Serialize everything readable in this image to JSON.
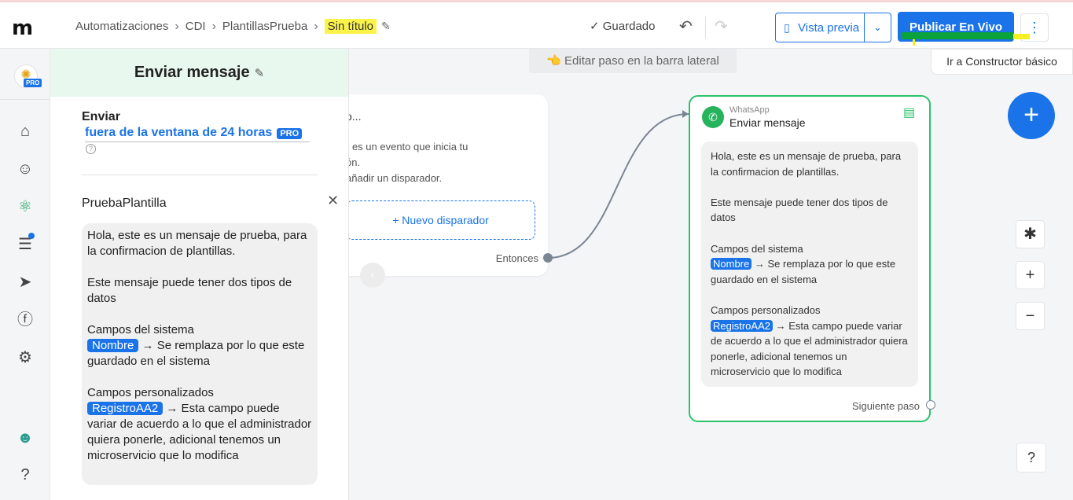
{
  "header": {
    "logo": "m",
    "breadcrumbs": [
      "Automatizaciones",
      "CDI",
      "PlantillasPrueba"
    ],
    "current_title": "Sin título",
    "saved_status": "Guardado",
    "preview_label": "Vista previa",
    "publish_label": "Publicar En Vivo",
    "basic_builder_tooltip": "Ir a Constructor básico"
  },
  "sidebar": {
    "pro_badge": "PRO",
    "icons": [
      "home-icon",
      "contacts-icon",
      "automation-icon",
      "chat-icon",
      "broadcast-icon",
      "facebook-icon",
      "settings-icon",
      "user-avatar",
      "help-icon"
    ]
  },
  "panel": {
    "title": "Enviar mensaje",
    "send_label": "Enviar",
    "send_value": "fuera de la ventana de 24 horas",
    "send_badge": "PRO",
    "template_name": "PruebaPlantilla",
    "message": {
      "line1": "Hola, este es un mensaje de prueba, para la confirmacion de plantillas.",
      "line2": "Este mensaje puede tener dos tipos de datos",
      "line3": "Campos del sistema",
      "var1": "Nombre",
      "line4": "→ Se remplaza por lo que este guardado en el sistema",
      "line5": "Campos personalizados",
      "var2": "RegistroAA2",
      "line6": "→ Esta campo puede variar de acuerdo a lo que el administrador quiera ponerle, adicional tenemos un microservicio que lo modifica"
    }
  },
  "canvas": {
    "hint": "👈 Editar paso en la barra lateral",
    "trigger_card": {
      "title": "o...",
      "desc_line1": "r es un evento que inicia tu",
      "desc_line2": "ón.",
      "desc_line3": "añadir un disparador.",
      "new_trigger": "+ Nuevo disparador",
      "then_label": "Entonces"
    },
    "whatsapp_card": {
      "app": "WhatsApp",
      "title": "Enviar mensaje",
      "next_label": "Siguiente paso"
    }
  },
  "colors": {
    "primary": "#1a73e8",
    "whatsapp_green": "#2bc36a",
    "highlight_yellow": "#fbf34a"
  }
}
